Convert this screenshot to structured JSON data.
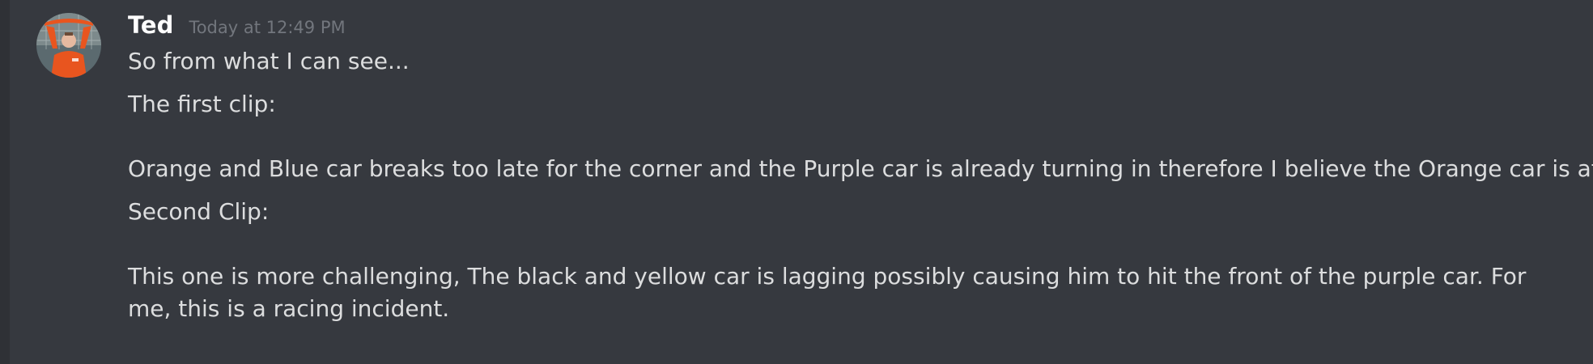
{
  "message": {
    "author": "Ted",
    "timestamp": "Today at 12:49 PM",
    "avatar_icon": "user-avatar-goalkeeper-photo",
    "colors": {
      "background": "#36393f",
      "username": "#ffffff",
      "timestamp": "#72767d",
      "text": "#dcddde"
    },
    "lines": [
      "So from what I can see...",
      "The first clip:",
      "Orange and Blue car breaks too late for the corner and the Purple car is already turning in therefore I believe the Orange car is at fault.",
      "Second Clip:",
      "This one is more challenging, The black and yellow car is lagging possibly causing him to hit the front of the purple car. For me, this is a racing incident."
    ]
  }
}
